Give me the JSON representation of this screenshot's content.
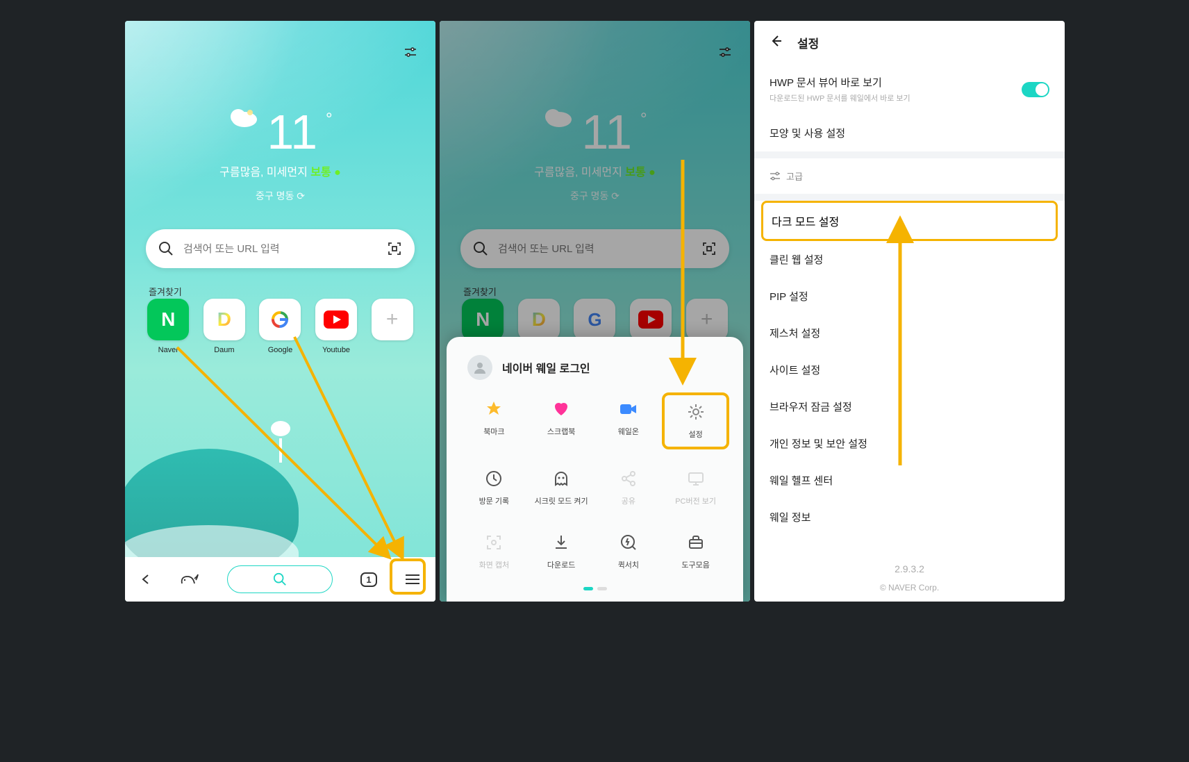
{
  "weather": {
    "temp": "11",
    "deg": "°",
    "cond": "구름많음, 미세먼지",
    "good": "보통",
    "location": "중구 명동 ⟳"
  },
  "search": {
    "placeholder": "검색어 또는 URL 입력"
  },
  "favoritesLabel": "즐겨찾기",
  "favorites": [
    {
      "label": "Naver",
      "color": "#03c75a",
      "letter": "N"
    },
    {
      "label": "Daum",
      "color": "#fff",
      "letter": "D"
    },
    {
      "label": "Google",
      "color": "#fff",
      "letter": "G"
    },
    {
      "label": "Youtube",
      "color": "#fff",
      "letter": "▶"
    }
  ],
  "bottombar": {
    "tabcount": "1"
  },
  "sheet": {
    "login": "네이버 웨일 로그인",
    "items": [
      {
        "label": "북마크",
        "icon": "star",
        "color": "#fdbb2c"
      },
      {
        "label": "스크랩북",
        "icon": "heart",
        "color": "#ff3399"
      },
      {
        "label": "웨일온",
        "icon": "video",
        "color": "#3c8bff"
      },
      {
        "label": "설정",
        "icon": "gear",
        "color": "#888",
        "highlight": true
      },
      {
        "label": "방문 기록",
        "icon": "clock"
      },
      {
        "label": "시크릿 모드 켜기",
        "icon": "ghost"
      },
      {
        "label": "공유",
        "icon": "share",
        "disabled": true
      },
      {
        "label": "PC버전 보기",
        "icon": "monitor",
        "disabled": true
      },
      {
        "label": "화면 캡처",
        "icon": "capture",
        "disabled": true
      },
      {
        "label": "다운로드",
        "icon": "download"
      },
      {
        "label": "퀵서치",
        "icon": "quicksearch"
      },
      {
        "label": "도구모음",
        "icon": "toolbox"
      }
    ]
  },
  "settings": {
    "title": "설정",
    "hwp_title": "HWP 문서 뷰어 바로 보기",
    "hwp_sub": "다운로드된 HWP 문서를 웨일에서 바로 보기",
    "appearance": "모양 및 사용 설정",
    "advanced": "고급",
    "items": [
      "다크 모드 설정",
      "클린 웹 설정",
      "PIP 설정",
      "제스처 설정",
      "사이트 설정",
      "브라우저 잠금 설정",
      "개인 정보 및 보안 설정",
      "웨일 헬프 센터",
      "웨일 정보"
    ],
    "version": "2.9.3.2",
    "copyright": "© NAVER Corp."
  }
}
